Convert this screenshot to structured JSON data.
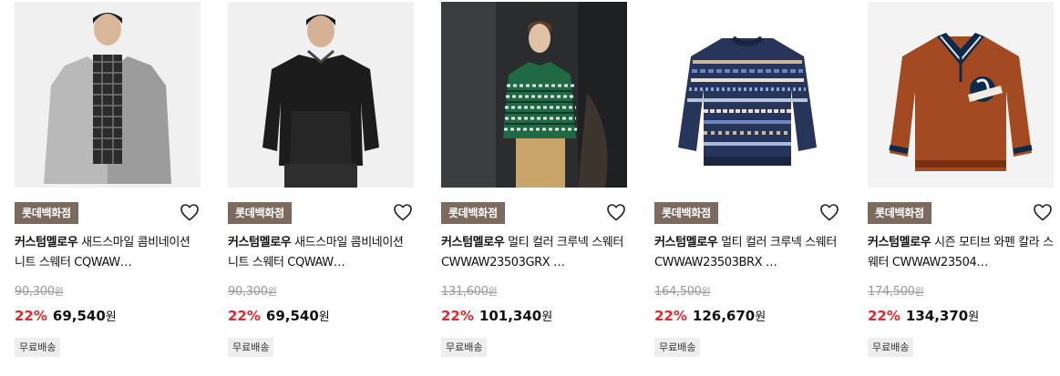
{
  "products": [
    {
      "store": "롯데백화점",
      "brand": "커스텀멜로우",
      "name": "새드스마일 콤비네이션 니트 스웨터 CQWAW…",
      "original_price": "90,300",
      "discount": "22%",
      "price": "69,540",
      "currency": "원",
      "shipping": "무료배송",
      "image": "product-photo-gray-knit-with-scarf"
    },
    {
      "store": "롯데백화점",
      "brand": "커스텀멜로우",
      "name": "새드스마일 콤비네이션 니트 스웨터 CQWAW…",
      "original_price": "90,300",
      "discount": "22%",
      "price": "69,540",
      "currency": "원",
      "shipping": "무료배송",
      "image": "product-photo-black-knit"
    },
    {
      "store": "롯데백화점",
      "brand": "커스텀멜로우",
      "name": "멀티 컬러 크루넥 스웨터 CWWAW23503GRX …",
      "original_price": "131,600",
      "discount": "22%",
      "price": "101,340",
      "currency": "원",
      "shipping": "무료배송",
      "image": "product-photo-green-fairisle-model"
    },
    {
      "store": "롯데백화점",
      "brand": "커스텀멜로우",
      "name": "멀티 컬러 크루넥 스웨터 CWWAW23503BRX …",
      "original_price": "164,500",
      "discount": "22%",
      "price": "126,670",
      "currency": "원",
      "shipping": "무료배송",
      "image": "product-photo-blue-striped-sweater"
    },
    {
      "store": "롯데백화점",
      "brand": "커스텀멜로우",
      "name": "시즌 모티브 와펜 칼라 스웨터 CWWAW23504…",
      "original_price": "174,500",
      "discount": "22%",
      "price": "134,370",
      "currency": "원",
      "shipping": "무료배송",
      "image": "product-photo-orange-polo-sweater"
    }
  ],
  "colors": {
    "store_badge": "#7c6a5f",
    "discount": "#e8262b",
    "original_price": "#9a9a9a",
    "shipping_badge": "#eeeeee"
  },
  "icons": {
    "wishlist": "heart-outline-icon"
  }
}
